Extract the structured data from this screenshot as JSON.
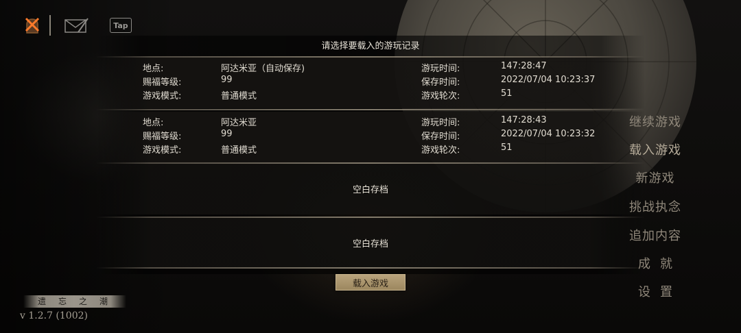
{
  "panel": {
    "title": "请选择要载入的游玩记录"
  },
  "labels": {
    "location": "地点:",
    "blessing_level": "赐福等级:",
    "game_mode": "游戏模式:",
    "play_time": "游玩时间:",
    "save_time": "保存时间:",
    "game_round": "游戏轮次:"
  },
  "saves": [
    {
      "location": "阿达米亚（自动保存)",
      "blessing_level": "99",
      "game_mode": "普通模式",
      "play_time": "147:28:47",
      "save_time": "2022/07/04 10:23:37",
      "game_round": "51"
    },
    {
      "location": "阿达米亚",
      "blessing_level": "99",
      "game_mode": "普通模式",
      "play_time": "147:28:43",
      "save_time": "2022/07/04 10:23:32",
      "game_round": "51"
    }
  ],
  "empty_slots": [
    "空白存档",
    "空白存档"
  ],
  "load_button": "载入游戏",
  "main_menu": [
    "继续游戏",
    "载入游戏",
    "新游戏",
    "挑战执念",
    "追加内容",
    "成就",
    "设置"
  ],
  "top_icons": [
    "close-bell-icon",
    "letter-icon",
    "tap-icon"
  ],
  "tap_label": "Tap",
  "logo_text": "遗忘之潮",
  "version": "v 1.2.7 (1002)",
  "colors": {
    "accent": "#b8a37c",
    "text": "#e0dbd0",
    "menu_text": "#8f877a"
  }
}
